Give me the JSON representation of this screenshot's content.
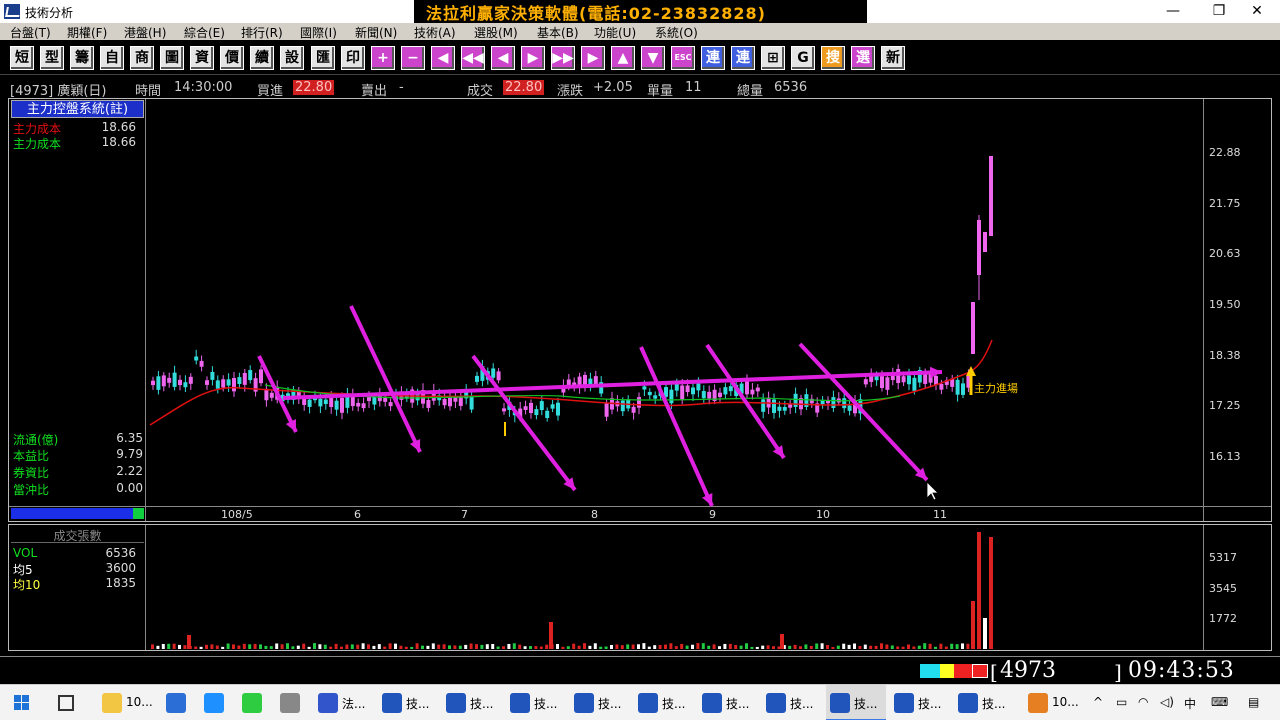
{
  "window": {
    "title": "技術分析",
    "banner": "法拉利贏家決策軟體(電話:02-23832828)",
    "controls": {
      "minimize": "—",
      "maximize": "❐",
      "close": "✕"
    }
  },
  "menu": [
    "台盤(T)",
    "期權(F)",
    "港盤(H)",
    "綜合(E)",
    "排行(R)",
    "國際(I)",
    "新聞(N)",
    "技術(A)",
    "選股(M)",
    "基本(B)",
    "功能(U)",
    "系統(O)"
  ],
  "toolbar": {
    "buttons": [
      {
        "label": "短",
        "style": "gray"
      },
      {
        "label": "型",
        "style": "gray"
      },
      {
        "label": "籌",
        "style": "gray"
      },
      {
        "label": "自",
        "style": "gray"
      },
      {
        "label": "商",
        "style": "gray"
      },
      {
        "label": "圖",
        "style": "gray"
      },
      {
        "label": "資",
        "style": "gray"
      },
      {
        "label": "價",
        "style": "gray"
      },
      {
        "label": "續",
        "style": "gray"
      },
      {
        "label": "設",
        "style": "gray"
      },
      {
        "label": "匯",
        "style": "gray"
      },
      {
        "label": "印",
        "style": "gray"
      },
      {
        "label": "+",
        "style": "purple"
      },
      {
        "label": "−",
        "style": "purple"
      },
      {
        "label": "◀",
        "style": "purple"
      },
      {
        "label": "◀◀",
        "style": "purple"
      },
      {
        "label": "◀",
        "style": "purple"
      },
      {
        "label": "▶",
        "style": "purple"
      },
      {
        "label": "▶▶",
        "style": "purple"
      },
      {
        "label": "▶",
        "style": "purple"
      },
      {
        "label": "▲",
        "style": "purple"
      },
      {
        "label": "▼",
        "style": "purple"
      },
      {
        "label": "ESC",
        "style": "purple"
      },
      {
        "label": "連",
        "style": "blue"
      },
      {
        "label": "連",
        "style": "blue"
      },
      {
        "label": "⊞",
        "style": "gray"
      },
      {
        "label": "G",
        "style": "gray"
      },
      {
        "label": "搜",
        "style": "orange"
      },
      {
        "label": "選",
        "style": "purple"
      },
      {
        "label": "新",
        "style": "gray"
      }
    ]
  },
  "quote": {
    "code_name": "[4973] 廣穎(日)",
    "time_label": "時間",
    "time": "14:30:00",
    "bid_label": "買進",
    "bid": "22.80",
    "ask_label": "賣出",
    "ask": "-",
    "last_label": "成交",
    "last": "22.80",
    "change_label": "漲跌",
    "change": "+2.05",
    "lot_label": "單量",
    "lot": "11",
    "volume_label": "總量",
    "volume": "6536"
  },
  "indicator": {
    "title": "主力控盤系統(註)",
    "rows": [
      {
        "label": "主力成本",
        "value": "18.66",
        "color": "#e01010"
      },
      {
        "label": "主力成本",
        "value": "18.66",
        "color": "#10e020"
      }
    ],
    "stats": [
      {
        "label": "流通(億)",
        "value": "6.35"
      },
      {
        "label": "本益比",
        "value": "9.79"
      },
      {
        "label": "券資比",
        "value": "2.22"
      },
      {
        "label": "當沖比",
        "value": "0.00"
      }
    ]
  },
  "annotation": {
    "entry_label": "主力進場"
  },
  "volume_panel": {
    "title": "成交張數",
    "rows": [
      {
        "label": "VOL",
        "value": "6536",
        "color": "#10e020"
      },
      {
        "label": "均5",
        "value": "3600",
        "color": "#ffffff"
      },
      {
        "label": "均10",
        "value": "1835",
        "color": "#ffff40"
      }
    ]
  },
  "chart_data": {
    "type": "candlestick",
    "y_ticks": [
      "22.88",
      "21.75",
      "20.63",
      "19.50",
      "18.38",
      "17.25",
      "16.13"
    ],
    "x_labels": [
      "108/5",
      "6",
      "7",
      "8",
      "9",
      "10",
      "11"
    ],
    "volume_ticks": [
      "5317",
      "3545",
      "1772"
    ],
    "up_color": "#ee66ee",
    "down_color": "#33dddd",
    "ma_colors": [
      "#e01010",
      "#10c020"
    ],
    "annotation_color": "#e020e0"
  },
  "status": {
    "code": "4973",
    "time": "09:43:53"
  },
  "taskbar": {
    "tasks": [
      "10...",
      "",
      "",
      "",
      "",
      "法...",
      "技...",
      "技...",
      "技...",
      "技...",
      "技...",
      "技...",
      "技...",
      "技...",
      "技...",
      "技...",
      "10..."
    ],
    "tray": {
      "ime": "中",
      "chevron": "^"
    }
  }
}
